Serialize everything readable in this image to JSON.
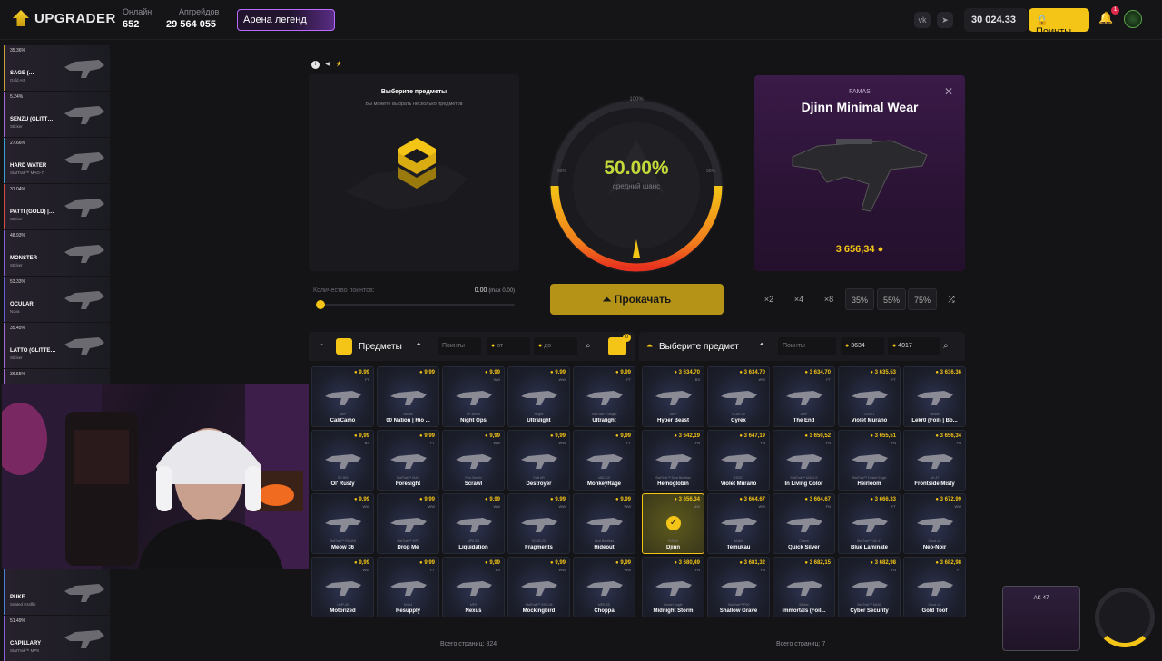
{
  "header": {
    "logo": "UPGRADER",
    "online_label": "Онлайн",
    "online_value": "652",
    "upgrades_label": "Апгрейдов",
    "upgrades_value": "29 564 055",
    "arena_label": "Арена легенд",
    "balance": "30 024.33",
    "points_button": "Поинты",
    "notifications": "1"
  },
  "feed": [
    {
      "pct": "35.36%",
      "name": "SAGE (…",
      "sub": "Gold Art",
      "color": "#c9a13b"
    },
    {
      "pct": "5.24%",
      "name": "SENZU (GLITT…",
      "sub": "Sticker",
      "color": "#a46ad6"
    },
    {
      "pct": "27.66%",
      "name": "HARD WATER",
      "sub": "StatTrak™ MAG-7",
      "color": "#3ba0d6"
    },
    {
      "pct": "31.04%",
      "name": "PATTI (GOLD) |…",
      "sub": "Sticker",
      "color": "#d64b4b"
    },
    {
      "pct": "48.93%",
      "name": "MONSTER",
      "sub": "Sticker",
      "color": "#8a5cd6"
    },
    {
      "pct": "53.33%",
      "name": "OCULAR",
      "sub": "Nova",
      "color": "#6a5cd6"
    },
    {
      "pct": "35.45%",
      "name": "LATTO (GLITTE…",
      "sub": "Sticker",
      "color": "#a46ad6"
    },
    {
      "pct": "36.55%",
      "name": "",
      "sub": "",
      "color": "#a46ad6"
    },
    {
      "pct": "",
      "name": "PUKE",
      "sub": "Sealed Graffiti",
      "color": "#4b7fd6"
    },
    {
      "pct": "51.49%",
      "name": "CAPILLARY",
      "sub": "StatTrak™ MP9",
      "color": "#8a5cd6"
    }
  ],
  "select_panel": {
    "title": "Выберите предметы",
    "subtitle": "Вы можете выбрать несколько предметов"
  },
  "chance": {
    "percent": "50.00%",
    "label": "средний шанс",
    "top_label": "100%",
    "left_label": "50%",
    "right_label": "50%",
    "value": 0.5
  },
  "result": {
    "brand": "FAMAS",
    "name": "Djinn Minimal Wear",
    "price": "3 656,34"
  },
  "slider": {
    "label": "Количество поинтов:",
    "value": "0.00",
    "max": "(max 0.00)"
  },
  "upgrade_button": "Прокачать",
  "multipliers": [
    "×2",
    "×4",
    "×8",
    "35%",
    "55%",
    "75%"
  ],
  "left_panel": {
    "title": "Предметы",
    "points_placeholder": "Поинты",
    "from_placeholder": "от",
    "to_placeholder": "до",
    "cart_count": "0",
    "pages": "Всего страниц: 824",
    "items": [
      {
        "price": "9,99",
        "wear": "FT",
        "type": "AWP",
        "skin": "CaliCamo"
      },
      {
        "price": "9,99",
        "wear": "",
        "type": "Sticker",
        "skin": "00 Nation | Rio ..."
      },
      {
        "price": "9,99",
        "wear": "WW",
        "type": "PP-Bizon",
        "skin": "Night Ops"
      },
      {
        "price": "9,99",
        "wear": "WW",
        "type": "Negev",
        "skin": "Ultralight"
      },
      {
        "price": "9,99",
        "wear": "FT",
        "type": "StatTrak™ Negev",
        "skin": "Ultralight"
      },
      {
        "price": "9,99",
        "wear": "BS",
        "type": "SG 553",
        "skin": "Ol' Rusty"
      },
      {
        "price": "9,99",
        "wear": "FT",
        "type": "StatTrak™ MAG",
        "skin": "Foresight"
      },
      {
        "price": "9,99",
        "wear": "WW",
        "type": "Five-SeveN",
        "skin": "Scrawl"
      },
      {
        "price": "9,99",
        "wear": "WW",
        "type": "Galil AR",
        "skin": "Destroyer"
      },
      {
        "price": "9,99",
        "wear": "FT",
        "type": "MAC-10",
        "skin": "MonkeyRage"
      },
      {
        "price": "9,99",
        "wear": "WW",
        "type": "StatTrak™ FAMAS",
        "skin": "Meow 36"
      },
      {
        "price": "9,99",
        "wear": "WW",
        "type": "StatTrak™ MP7",
        "skin": "Drop Me"
      },
      {
        "price": "9,99",
        "wear": "WW",
        "type": "MP5-SD",
        "skin": "Liquidation"
      },
      {
        "price": "9,99",
        "wear": "WW",
        "type": "SCAR-20",
        "skin": "Fragments"
      },
      {
        "price": "9,99",
        "wear": "WW",
        "type": "Dual Berettas",
        "skin": "Hideout"
      },
      {
        "price": "9,99",
        "wear": "WW",
        "type": "UMP-45",
        "skin": "Motorized"
      },
      {
        "price": "9,99",
        "wear": "FT",
        "type": "M4A4",
        "skin": "Resupply"
      },
      {
        "price": "9,99",
        "wear": "BS",
        "type": "MP9",
        "skin": "Nexus"
      },
      {
        "price": "9,99",
        "wear": "WW",
        "type": "StatTrak™ SSG 08",
        "skin": "Mockingbird"
      },
      {
        "price": "9,99",
        "wear": "WW",
        "type": "MP5-SD",
        "skin": "Choppa"
      }
    ]
  },
  "right_panel": {
    "title": "Выберите предмет",
    "points_placeholder": "Поинты",
    "from_value": "3634",
    "to_value": "4017",
    "pages": "Всего страниц: 7",
    "items": [
      {
        "price": "3 634,70",
        "wear": "BS",
        "type": "AWP",
        "skin": "Hyper Beast"
      },
      {
        "price": "3 634,70",
        "wear": "WW",
        "type": "SCAR-20",
        "skin": "Cyrex"
      },
      {
        "price": "3 634,70",
        "wear": "FT",
        "type": "AWP",
        "skin": "The End"
      },
      {
        "price": "3 635,53",
        "wear": "FT",
        "type": "G3SG1",
        "skin": "Violet Murano"
      },
      {
        "price": "3 636,36",
        "wear": "",
        "type": "Sticker",
        "skin": "Lekr0 (Foil) | Bo..."
      },
      {
        "price": "3 642,19",
        "wear": "FN",
        "type": "StatTrak™ Dual Berettas",
        "skin": "Hemoglobin"
      },
      {
        "price": "3 647,19",
        "wear": "FN",
        "type": "G3SG1",
        "skin": "Violet Murano"
      },
      {
        "price": "3 650,52",
        "wear": "FN",
        "type": "StatTrak™ M4A1-S",
        "skin": "In Living Color"
      },
      {
        "price": "3 655,51",
        "wear": "FN",
        "type": "StatTrak™ Desert Eagle",
        "skin": "Heirloom"
      },
      {
        "price": "3 656,34",
        "wear": "FN",
        "type": "AK-47",
        "skin": "Frontside Misty"
      },
      {
        "price": "3 656,34",
        "wear": "MW",
        "type": "FAMAS",
        "skin": "Djinn",
        "selected": true
      },
      {
        "price": "3 664,67",
        "wear": "WW",
        "type": "M4A4",
        "skin": "Temukau"
      },
      {
        "price": "3 664,67",
        "wear": "FN",
        "type": "Charm",
        "skin": "Quick Silver"
      },
      {
        "price": "3 666,33",
        "wear": "FT",
        "type": "StatTrak™ AK-47",
        "skin": "Blue Laminate"
      },
      {
        "price": "3 672,99",
        "wear": "WW",
        "type": "Glock-18",
        "skin": "Neo-Noir"
      },
      {
        "price": "3 680,49",
        "wear": "FN",
        "type": "Desert Eagle",
        "skin": "Midnight Storm"
      },
      {
        "price": "3 681,32",
        "wear": "FN",
        "type": "StatTrak™ P90",
        "skin": "Shallow Grave"
      },
      {
        "price": "3 682,15",
        "wear": "",
        "type": "Sticker",
        "skin": "Immortals (Foil..."
      },
      {
        "price": "3 682,98",
        "wear": "FN",
        "type": "StatTrak™ M4A1",
        "skin": "Cyber Security"
      },
      {
        "price": "3 682,98",
        "wear": "FT",
        "type": "Glock-18",
        "skin": "Gold Toof"
      }
    ]
  },
  "mini_widget": {
    "name": "AK-47"
  }
}
